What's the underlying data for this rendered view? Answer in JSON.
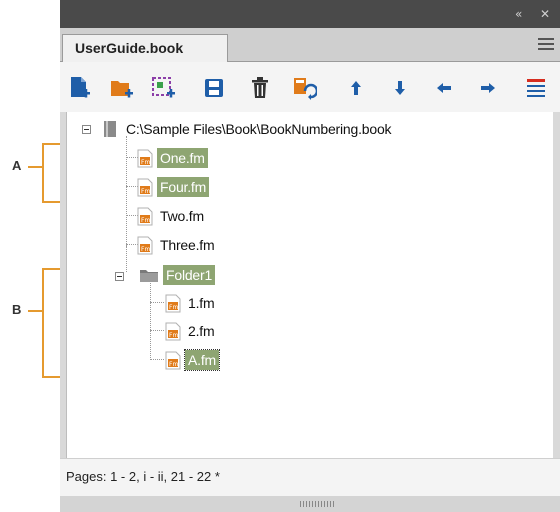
{
  "callouts": {
    "a": "A",
    "b": "B"
  },
  "panel": {
    "collapse_glyph": "«",
    "close_glyph": "✕",
    "tab_label": "UserGuide.book"
  },
  "toolbar": {
    "buttons": [
      "add-file-icon",
      "add-folder-icon",
      "add-group-icon",
      "save-icon",
      "delete-icon",
      "update-book-icon",
      "move-up-icon",
      "move-down-icon",
      "move-left-icon",
      "move-right-icon",
      "book-menu-icon"
    ]
  },
  "tree": {
    "book": "C:\\Sample Files\\Book\\BookNumbering.book",
    "files": [
      "One.fm",
      "Four.fm",
      "Two.fm",
      "Three.fm"
    ],
    "folder": "Folder1",
    "folder_files": [
      "1.fm",
      "2.fm",
      "A.fm"
    ]
  },
  "status": {
    "pages": "Pages: 1 - 2, i - ii, 21 - 22 *"
  },
  "colors": {
    "accent_blue": "#1f5ea8",
    "folder_orange": "#e07b1a",
    "selection_green": "#8ea572",
    "callout_orange": "#e59a2f",
    "toolbar_red": "#d62d20"
  }
}
